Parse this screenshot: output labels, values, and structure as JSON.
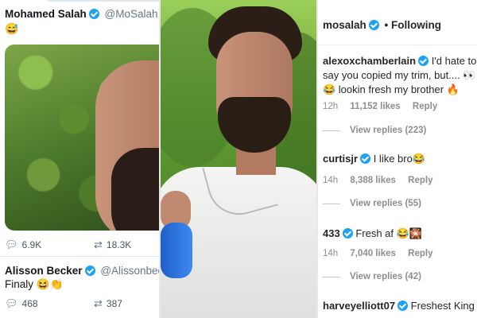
{
  "twitter": {
    "tweet": {
      "name": "Mohamed Salah",
      "handle": "@MoSalah",
      "emoji": "😅",
      "replies": "6.9K",
      "retweets": "18.3K"
    },
    "reply": {
      "name": "Alisson Becker",
      "handle": "@Alissonbeck",
      "text": "Finaly 😆👏",
      "replies": "468",
      "retweets": "387"
    },
    "icons": {
      "reply": "reply-bubble-icon",
      "retweet": "retweet-icon",
      "verified": "verified-badge-icon"
    }
  },
  "instagram": {
    "header": {
      "username": "mosalah",
      "following": "• Following"
    },
    "comments": [
      {
        "user": "alexoxchamberlain",
        "text": "I'd hate to say you copied my trim, but.... 👀 😂 lookin fresh my brother 🔥",
        "time": "12h",
        "likes": "11,152 likes",
        "reply": "Reply",
        "view_replies": "View replies (223)"
      },
      {
        "user": "curtisjr",
        "text": "I like bro😂",
        "time": "14h",
        "likes": "8,388 likes",
        "reply": "Reply",
        "view_replies": "View replies (55)"
      },
      {
        "user": "433",
        "text": "Fresh af 😂🎇",
        "time": "14h",
        "likes": "7,040 likes",
        "reply": "Reply",
        "view_replies": "View replies (42)"
      },
      {
        "user": "harveyelliott07",
        "text": "Freshest King"
      }
    ]
  },
  "colors": {
    "twitter_blue": "#1da1f2",
    "ig_text": "#262626",
    "ig_meta": "#8e8e8e"
  }
}
